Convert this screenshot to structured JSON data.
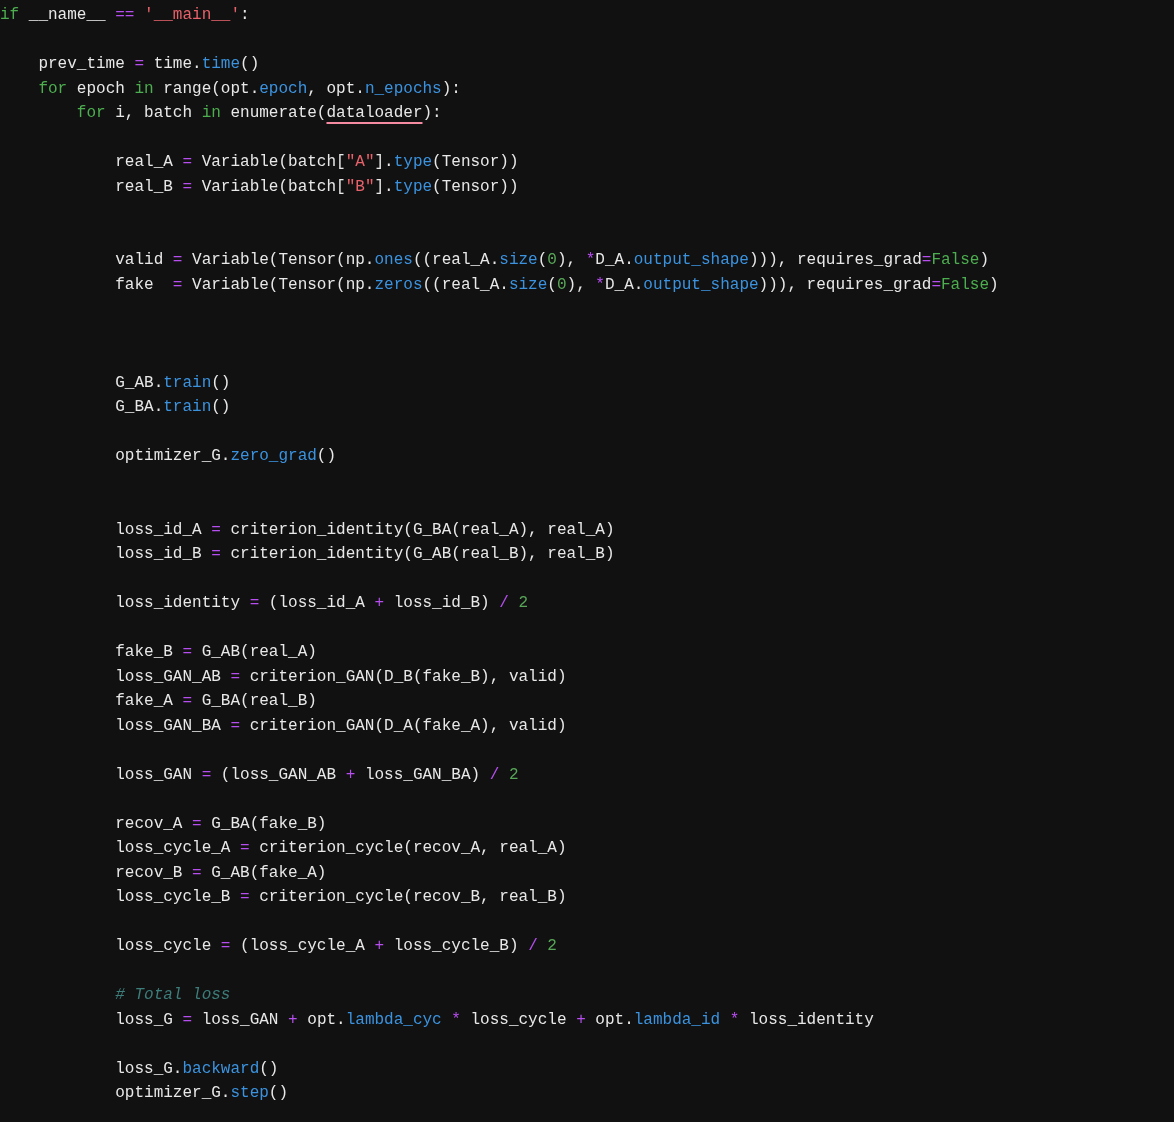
{
  "code_lines": [
    {
      "kind": "code",
      "tokens": [
        {
          "kind": "keyword",
          "text": "if"
        },
        {
          "kind": "plain",
          "text": " __name__ "
        },
        {
          "kind": "operator",
          "text": "== "
        },
        {
          "kind": "string",
          "text": "'__main__'"
        },
        {
          "kind": "plain",
          "text": ":"
        }
      ]
    },
    {
      "kind": "blank"
    },
    {
      "kind": "code",
      "tokens": [
        {
          "kind": "plain",
          "text": "    prev_time "
        },
        {
          "kind": "operator",
          "text": "="
        },
        {
          "kind": "plain",
          "text": " time."
        },
        {
          "kind": "attribute",
          "text": "time"
        },
        {
          "kind": "plain",
          "text": "()"
        }
      ]
    },
    {
      "kind": "code",
      "tokens": [
        {
          "kind": "keyword",
          "text": "    for"
        },
        {
          "kind": "plain",
          "text": " epoch "
        },
        {
          "kind": "keyword",
          "text": "in"
        },
        {
          "kind": "plain",
          "text": " range(opt."
        },
        {
          "kind": "attribute",
          "text": "epoch"
        },
        {
          "kind": "plain",
          "text": ", opt."
        },
        {
          "kind": "attribute",
          "text": "n_epochs"
        },
        {
          "kind": "plain",
          "text": "):"
        }
      ]
    },
    {
      "kind": "code",
      "tokens": [
        {
          "kind": "keyword",
          "text": "        for"
        },
        {
          "kind": "plain",
          "text": " i, batch "
        },
        {
          "kind": "keyword",
          "text": "in"
        },
        {
          "kind": "plain",
          "text": " enumerate("
        },
        {
          "kind": "plain",
          "text": "dataloader",
          "underlined": true
        },
        {
          "kind": "plain",
          "text": "):"
        }
      ]
    },
    {
      "kind": "blank"
    },
    {
      "kind": "code",
      "tokens": [
        {
          "kind": "plain",
          "text": "            real_A "
        },
        {
          "kind": "operator",
          "text": "="
        },
        {
          "kind": "plain",
          "text": " Variable(batch["
        },
        {
          "kind": "string",
          "text": "\"A\""
        },
        {
          "kind": "plain",
          "text": "]."
        },
        {
          "kind": "attribute",
          "text": "type"
        },
        {
          "kind": "plain",
          "text": "(Tensor))"
        }
      ]
    },
    {
      "kind": "code",
      "tokens": [
        {
          "kind": "plain",
          "text": "            real_B "
        },
        {
          "kind": "operator",
          "text": "="
        },
        {
          "kind": "plain",
          "text": " Variable(batch["
        },
        {
          "kind": "string",
          "text": "\"B\""
        },
        {
          "kind": "plain",
          "text": "]."
        },
        {
          "kind": "attribute",
          "text": "type"
        },
        {
          "kind": "plain",
          "text": "(Tensor))"
        }
      ]
    },
    {
      "kind": "blank"
    },
    {
      "kind": "blank"
    },
    {
      "kind": "code",
      "tokens": [
        {
          "kind": "plain",
          "text": "            valid "
        },
        {
          "kind": "operator",
          "text": "="
        },
        {
          "kind": "plain",
          "text": " Variable(Tensor(np."
        },
        {
          "kind": "attribute",
          "text": "ones"
        },
        {
          "kind": "plain",
          "text": "((real_A."
        },
        {
          "kind": "attribute",
          "text": "size"
        },
        {
          "kind": "plain",
          "text": "("
        },
        {
          "kind": "number",
          "text": "0"
        },
        {
          "kind": "plain",
          "text": "), "
        },
        {
          "kind": "operator",
          "text": "*"
        },
        {
          "kind": "plain",
          "text": "D_A."
        },
        {
          "kind": "attribute",
          "text": "output_shape"
        },
        {
          "kind": "plain",
          "text": "))), requires_grad"
        },
        {
          "kind": "operator",
          "text": "="
        },
        {
          "kind": "keyword",
          "text": "False"
        },
        {
          "kind": "plain",
          "text": ")"
        }
      ]
    },
    {
      "kind": "code",
      "tokens": [
        {
          "kind": "plain",
          "text": "            fake  "
        },
        {
          "kind": "operator",
          "text": "="
        },
        {
          "kind": "plain",
          "text": " Variable(Tensor(np."
        },
        {
          "kind": "attribute",
          "text": "zeros"
        },
        {
          "kind": "plain",
          "text": "((real_A."
        },
        {
          "kind": "attribute",
          "text": "size"
        },
        {
          "kind": "plain",
          "text": "("
        },
        {
          "kind": "number",
          "text": "0"
        },
        {
          "kind": "plain",
          "text": "), "
        },
        {
          "kind": "operator",
          "text": "*"
        },
        {
          "kind": "plain",
          "text": "D_A."
        },
        {
          "kind": "attribute",
          "text": "output_shape"
        },
        {
          "kind": "plain",
          "text": "))), requires_grad"
        },
        {
          "kind": "operator",
          "text": "="
        },
        {
          "kind": "keyword",
          "text": "False"
        },
        {
          "kind": "plain",
          "text": ")"
        }
      ]
    },
    {
      "kind": "blank"
    },
    {
      "kind": "blank"
    },
    {
      "kind": "blank"
    },
    {
      "kind": "code",
      "tokens": [
        {
          "kind": "plain",
          "text": "            G_AB."
        },
        {
          "kind": "attribute",
          "text": "train"
        },
        {
          "kind": "plain",
          "text": "()"
        }
      ]
    },
    {
      "kind": "code",
      "tokens": [
        {
          "kind": "plain",
          "text": "            G_BA."
        },
        {
          "kind": "attribute",
          "text": "train"
        },
        {
          "kind": "plain",
          "text": "()"
        }
      ]
    },
    {
      "kind": "blank"
    },
    {
      "kind": "code",
      "tokens": [
        {
          "kind": "plain",
          "text": "            optimizer_G."
        },
        {
          "kind": "attribute",
          "text": "zero_grad"
        },
        {
          "kind": "plain",
          "text": "()"
        }
      ]
    },
    {
      "kind": "blank"
    },
    {
      "kind": "blank"
    },
    {
      "kind": "code",
      "tokens": [
        {
          "kind": "plain",
          "text": "            loss_id_A "
        },
        {
          "kind": "operator",
          "text": "="
        },
        {
          "kind": "plain",
          "text": " criterion_identity(G_BA(real_A), real_A)"
        }
      ]
    },
    {
      "kind": "code",
      "tokens": [
        {
          "kind": "plain",
          "text": "            loss_id_B "
        },
        {
          "kind": "operator",
          "text": "="
        },
        {
          "kind": "plain",
          "text": " criterion_identity(G_AB(real_B), real_B)"
        }
      ]
    },
    {
      "kind": "blank"
    },
    {
      "kind": "code",
      "tokens": [
        {
          "kind": "plain",
          "text": "            loss_identity "
        },
        {
          "kind": "operator",
          "text": "="
        },
        {
          "kind": "plain",
          "text": " (loss_id_A "
        },
        {
          "kind": "operator",
          "text": "+"
        },
        {
          "kind": "plain",
          "text": " loss_id_B) "
        },
        {
          "kind": "operator",
          "text": "/ "
        },
        {
          "kind": "number",
          "text": "2"
        }
      ]
    },
    {
      "kind": "blank"
    },
    {
      "kind": "code",
      "tokens": [
        {
          "kind": "plain",
          "text": "            fake_B "
        },
        {
          "kind": "operator",
          "text": "="
        },
        {
          "kind": "plain",
          "text": " G_AB(real_A)"
        }
      ]
    },
    {
      "kind": "code",
      "tokens": [
        {
          "kind": "plain",
          "text": "            loss_GAN_AB "
        },
        {
          "kind": "operator",
          "text": "="
        },
        {
          "kind": "plain",
          "text": " criterion_GAN(D_B(fake_B), valid)"
        }
      ]
    },
    {
      "kind": "code",
      "tokens": [
        {
          "kind": "plain",
          "text": "            fake_A "
        },
        {
          "kind": "operator",
          "text": "="
        },
        {
          "kind": "plain",
          "text": " G_BA(real_B)"
        }
      ]
    },
    {
      "kind": "code",
      "tokens": [
        {
          "kind": "plain",
          "text": "            loss_GAN_BA "
        },
        {
          "kind": "operator",
          "text": "="
        },
        {
          "kind": "plain",
          "text": " criterion_GAN(D_A(fake_A), valid)"
        }
      ]
    },
    {
      "kind": "blank"
    },
    {
      "kind": "code",
      "tokens": [
        {
          "kind": "plain",
          "text": "            loss_GAN "
        },
        {
          "kind": "operator",
          "text": "="
        },
        {
          "kind": "plain",
          "text": " (loss_GAN_AB "
        },
        {
          "kind": "operator",
          "text": "+"
        },
        {
          "kind": "plain",
          "text": " loss_GAN_BA) "
        },
        {
          "kind": "operator",
          "text": "/ "
        },
        {
          "kind": "number",
          "text": "2"
        }
      ]
    },
    {
      "kind": "blank"
    },
    {
      "kind": "code",
      "tokens": [
        {
          "kind": "plain",
          "text": "            recov_A "
        },
        {
          "kind": "operator",
          "text": "="
        },
        {
          "kind": "plain",
          "text": " G_BA(fake_B)"
        }
      ]
    },
    {
      "kind": "code",
      "tokens": [
        {
          "kind": "plain",
          "text": "            loss_cycle_A "
        },
        {
          "kind": "operator",
          "text": "="
        },
        {
          "kind": "plain",
          "text": " criterion_cycle(recov_A, real_A)"
        }
      ]
    },
    {
      "kind": "code",
      "tokens": [
        {
          "kind": "plain",
          "text": "            recov_B "
        },
        {
          "kind": "operator",
          "text": "="
        },
        {
          "kind": "plain",
          "text": " G_AB(fake_A)"
        }
      ]
    },
    {
      "kind": "code",
      "tokens": [
        {
          "kind": "plain",
          "text": "            loss_cycle_B "
        },
        {
          "kind": "operator",
          "text": "="
        },
        {
          "kind": "plain",
          "text": " criterion_cycle(recov_B, real_B)"
        }
      ]
    },
    {
      "kind": "blank"
    },
    {
      "kind": "code",
      "tokens": [
        {
          "kind": "plain",
          "text": "            loss_cycle "
        },
        {
          "kind": "operator",
          "text": "="
        },
        {
          "kind": "plain",
          "text": " (loss_cycle_A "
        },
        {
          "kind": "operator",
          "text": "+"
        },
        {
          "kind": "plain",
          "text": " loss_cycle_B) "
        },
        {
          "kind": "operator",
          "text": "/ "
        },
        {
          "kind": "number",
          "text": "2"
        }
      ]
    },
    {
      "kind": "blank"
    },
    {
      "kind": "code",
      "tokens": [
        {
          "kind": "comment",
          "text": "            # Total loss"
        }
      ]
    },
    {
      "kind": "code",
      "tokens": [
        {
          "kind": "plain",
          "text": "            loss_G "
        },
        {
          "kind": "operator",
          "text": "="
        },
        {
          "kind": "plain",
          "text": " loss_GAN "
        },
        {
          "kind": "operator",
          "text": "+"
        },
        {
          "kind": "plain",
          "text": " opt."
        },
        {
          "kind": "attribute",
          "text": "lambda_cyc"
        },
        {
          "kind": "operator",
          "text": " *"
        },
        {
          "kind": "plain",
          "text": " loss_cycle "
        },
        {
          "kind": "operator",
          "text": "+"
        },
        {
          "kind": "plain",
          "text": " opt."
        },
        {
          "kind": "attribute",
          "text": "lambda_id"
        },
        {
          "kind": "operator",
          "text": " *"
        },
        {
          "kind": "plain",
          "text": " loss_identity"
        }
      ]
    },
    {
      "kind": "blank"
    },
    {
      "kind": "code",
      "tokens": [
        {
          "kind": "plain",
          "text": "            loss_G."
        },
        {
          "kind": "attribute",
          "text": "backward"
        },
        {
          "kind": "plain",
          "text": "()"
        }
      ]
    },
    {
      "kind": "code",
      "tokens": [
        {
          "kind": "plain",
          "text": "            optimizer_G."
        },
        {
          "kind": "attribute",
          "text": "step"
        },
        {
          "kind": "plain",
          "text": "()"
        }
      ]
    }
  ]
}
